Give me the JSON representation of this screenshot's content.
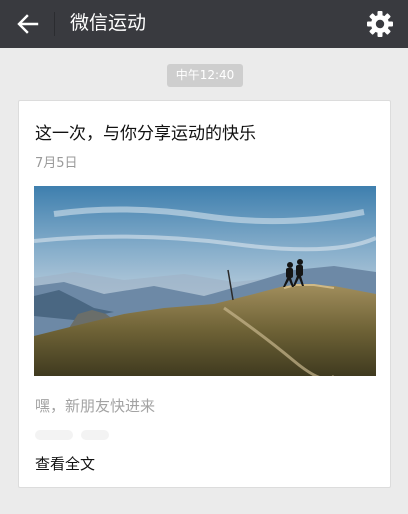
{
  "header": {
    "title": "微信运动",
    "back_icon": "arrow-left-icon",
    "settings_icon": "gear-icon",
    "background": "#393a3f"
  },
  "timestamp": "中午12:40",
  "card": {
    "title": "这一次，与你分享运动的快乐",
    "date": "7月5日",
    "image": "hikers-on-mountain-ridge",
    "description": "嘿，新朋友快进来",
    "read_more": "查看全文"
  }
}
